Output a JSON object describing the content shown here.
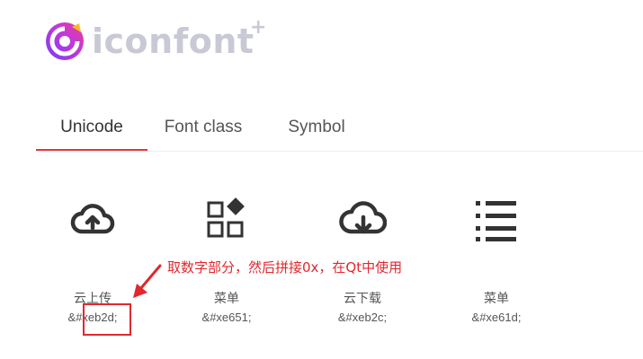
{
  "logo": {
    "text": "iconfont",
    "plus": "+",
    "brand_colors": [
      "#7b3cf5",
      "#f03a8a",
      "#ffb52b"
    ]
  },
  "tabs": [
    {
      "label": "Unicode",
      "active": true
    },
    {
      "label": "Font class",
      "active": false
    },
    {
      "label": "Symbol",
      "active": false
    }
  ],
  "icons": [
    {
      "icon": "cloud-upload-icon",
      "name": "云上传",
      "code": "&#xeb2d;"
    },
    {
      "icon": "grid-apps-icon",
      "name": "菜单",
      "code": "&#xe651;"
    },
    {
      "icon": "cloud-download-icon",
      "name": "云下载",
      "code": "&#xeb2c;"
    },
    {
      "icon": "list-menu-icon",
      "name": "菜单",
      "code": "&#xe61d;"
    }
  ],
  "annotation": {
    "text": "取数字部分，然后拼接0x，在Qt中使用",
    "color": "#e0282e"
  },
  "accent": "#e3373b"
}
